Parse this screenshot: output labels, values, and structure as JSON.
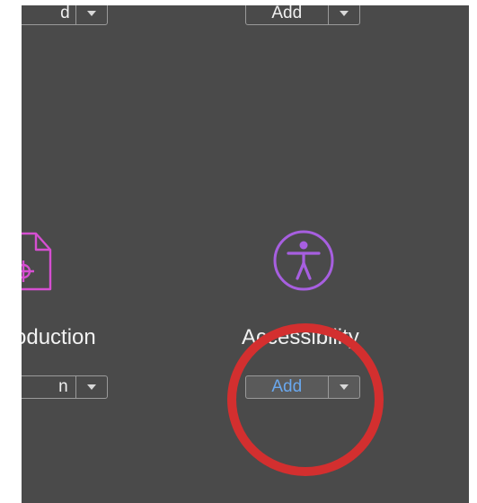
{
  "tools": {
    "top_left": {
      "button_label": "d"
    },
    "top_right": {
      "button_label": "Add"
    },
    "print_production": {
      "label": "oduction",
      "button_label": "n",
      "icon": "print-production-icon",
      "icon_color": "#d64fd1"
    },
    "accessibility": {
      "label": "Accessibility",
      "button_label": "Add",
      "icon": "accessibility-icon",
      "icon_color": "#a75fe0",
      "button_text_color": "#6aa8ee"
    }
  },
  "annotation": {
    "shape": "circle",
    "color": "#d32f2f"
  },
  "colors": {
    "panel_bg": "#4a4a4a",
    "button_border": "#9a9a9a"
  }
}
